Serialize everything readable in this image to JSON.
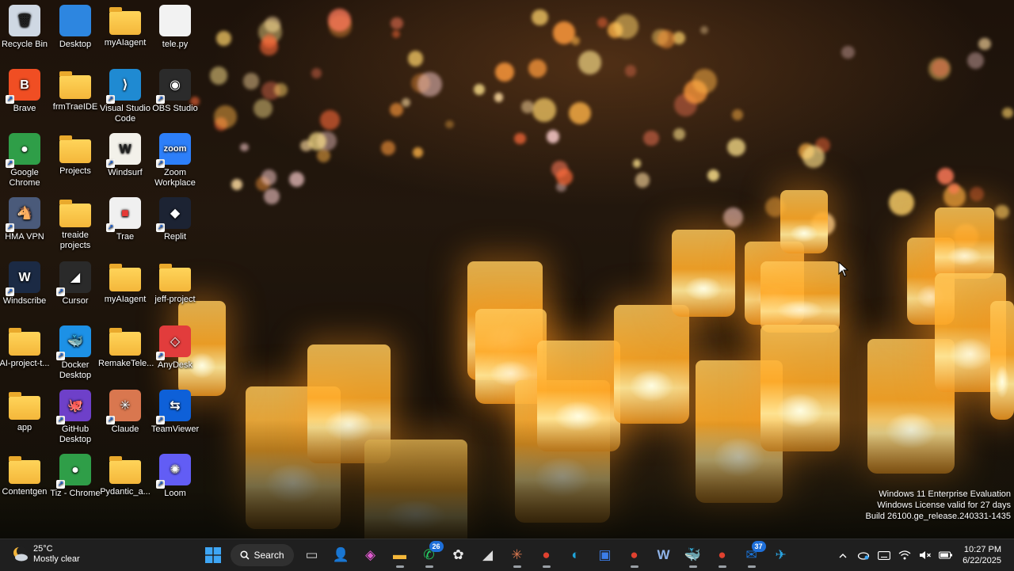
{
  "desktop_icons": [
    {
      "label": "Recycle Bin",
      "color": "#cfd8e3",
      "glyph": "🗑",
      "folder": false,
      "shortcut": false
    },
    {
      "label": "Desktop",
      "color": "#2d86e0",
      "glyph": "",
      "folder": false,
      "shortcut": false
    },
    {
      "label": "myAIagent",
      "color": "#f4b73a",
      "glyph": "",
      "folder": true,
      "shortcut": false
    },
    {
      "label": "tele.py",
      "color": "#f2f2f2",
      "glyph": "",
      "folder": false,
      "shortcut": false
    },
    {
      "label": "Brave",
      "color": "#f04e23",
      "glyph": "B",
      "folder": false,
      "shortcut": true
    },
    {
      "label": "frmTraeIDE",
      "color": "#f4b73a",
      "glyph": "",
      "folder": true,
      "shortcut": false
    },
    {
      "label": "Visual Studio Code",
      "color": "#1f8ad2",
      "glyph": "⟩",
      "folder": false,
      "shortcut": true
    },
    {
      "label": "OBS Studio",
      "color": "#2b2b2b",
      "glyph": "◉",
      "folder": false,
      "shortcut": true
    },
    {
      "label": "Google Chrome",
      "color": "#2f9e48",
      "glyph": "●",
      "folder": false,
      "shortcut": true
    },
    {
      "label": "Projects",
      "color": "#f4b73a",
      "glyph": "",
      "folder": true,
      "shortcut": false
    },
    {
      "label": "Windsurf",
      "color": "#f3f1ea",
      "glyph": "W",
      "folder": false,
      "shortcut": true
    },
    {
      "label": "Zoom Workplace",
      "color": "#2d7ff9",
      "glyph": "zoom",
      "folder": false,
      "shortcut": true
    },
    {
      "label": "HMA VPN",
      "color": "#4a5a7a",
      "glyph": "🐴",
      "folder": false,
      "shortcut": true
    },
    {
      "label": "treaide projects",
      "color": "#f4b73a",
      "glyph": "",
      "folder": true,
      "shortcut": false
    },
    {
      "label": "Trae",
      "color": "#f0f0f0",
      "glyph": "■",
      "folder": false,
      "shortcut": true
    },
    {
      "label": "Replit",
      "color": "#1c2333",
      "glyph": "◆",
      "folder": false,
      "shortcut": true
    },
    {
      "label": "Windscribe",
      "color": "#1b2a44",
      "glyph": "W",
      "folder": false,
      "shortcut": true
    },
    {
      "label": "Cursor",
      "color": "#2a2a2a",
      "glyph": "◢",
      "folder": false,
      "shortcut": true
    },
    {
      "label": "myAIagent",
      "color": "#f4b73a",
      "glyph": "",
      "folder": true,
      "shortcut": false
    },
    {
      "label": "jeff-project",
      "color": "#f4b73a",
      "glyph": "",
      "folder": true,
      "shortcut": false
    },
    {
      "label": "AI-project-t...",
      "color": "#f4b73a",
      "glyph": "",
      "folder": true,
      "shortcut": false
    },
    {
      "label": "Docker Desktop",
      "color": "#1d91e6",
      "glyph": "🐳",
      "folder": false,
      "shortcut": true
    },
    {
      "label": "RemakeTele...",
      "color": "#f4b73a",
      "glyph": "",
      "folder": true,
      "shortcut": false
    },
    {
      "label": "AnyDesk",
      "color": "#e23c3c",
      "glyph": "◇",
      "folder": false,
      "shortcut": true
    },
    {
      "label": "app",
      "color": "#f4b73a",
      "glyph": "",
      "folder": true,
      "shortcut": false
    },
    {
      "label": "GitHub Desktop",
      "color": "#6e40c9",
      "glyph": "🐙",
      "folder": false,
      "shortcut": true
    },
    {
      "label": "Claude",
      "color": "#d9774f",
      "glyph": "✳",
      "folder": false,
      "shortcut": true
    },
    {
      "label": "TeamViewer",
      "color": "#0e60d8",
      "glyph": "⇆",
      "folder": false,
      "shortcut": true
    },
    {
      "label": "Contentgen",
      "color": "#f4b73a",
      "glyph": "",
      "folder": true,
      "shortcut": false
    },
    {
      "label": "Tiz - Chrome",
      "color": "#2f9e48",
      "glyph": "●",
      "folder": false,
      "shortcut": true
    },
    {
      "label": "Pydantic_a...",
      "color": "#f4b73a",
      "glyph": "",
      "folder": true,
      "shortcut": false
    },
    {
      "label": "Loom",
      "color": "#625df5",
      "glyph": "✺",
      "folder": false,
      "shortcut": true
    }
  ],
  "watermark": {
    "line1": "Windows 11 Enterprise Evaluation",
    "line2": "Windows License valid for 27 days",
    "line3": "Build 26100.ge_release.240331-1435"
  },
  "weather": {
    "temp": "25°C",
    "condition": "Mostly clear",
    "icon": "moon-cloud-icon"
  },
  "taskbar": {
    "search_label": "Search",
    "apps": [
      {
        "name": "task-view",
        "color": "#d0d0d0",
        "glyph": "▭",
        "badge": "",
        "active": false
      },
      {
        "name": "teams-chat",
        "color": "#4aa0f0",
        "glyph": "👤",
        "badge": "",
        "active": false
      },
      {
        "name": "copilot",
        "color": "#e05bd0",
        "glyph": "◈",
        "badge": "",
        "active": false
      },
      {
        "name": "file-explorer",
        "color": "#f4b73a",
        "glyph": "▬",
        "badge": "",
        "active": true
      },
      {
        "name": "whatsapp",
        "color": "#25d366",
        "glyph": "✆",
        "badge": "26",
        "active": true
      },
      {
        "name": "chatgpt",
        "color": "#e8e8e8",
        "glyph": "✿",
        "badge": "",
        "active": false
      },
      {
        "name": "cursor",
        "color": "#dcdcdc",
        "glyph": "◢",
        "badge": "",
        "active": false
      },
      {
        "name": "claude",
        "color": "#d9774f",
        "glyph": "✳",
        "badge": "",
        "active": true
      },
      {
        "name": "chrome",
        "color": "#e0412f",
        "glyph": "●",
        "badge": "",
        "active": true
      },
      {
        "name": "edge",
        "color": "#1fa3d8",
        "glyph": "◐",
        "badge": "",
        "active": false
      },
      {
        "name": "remote-desktop",
        "color": "#3c7ee8",
        "glyph": "▣",
        "badge": "",
        "active": false
      },
      {
        "name": "chrome-2",
        "color": "#e0412f",
        "glyph": "●",
        "badge": "",
        "active": true
      },
      {
        "name": "windscribe",
        "color": "#8fb3e8",
        "glyph": "W",
        "badge": "",
        "active": false
      },
      {
        "name": "docker",
        "color": "#1d91e6",
        "glyph": "🐳",
        "badge": "",
        "active": true
      },
      {
        "name": "chrome-3",
        "color": "#e0412f",
        "glyph": "●",
        "badge": "",
        "active": true
      },
      {
        "name": "outlook",
        "color": "#1a73d8",
        "glyph": "✉",
        "badge": "37",
        "active": true
      },
      {
        "name": "telegram",
        "color": "#2aa3e0",
        "glyph": "✈",
        "badge": "",
        "active": false
      }
    ]
  },
  "tray": {
    "time": "10:27 PM",
    "date": "6/22/2025"
  }
}
